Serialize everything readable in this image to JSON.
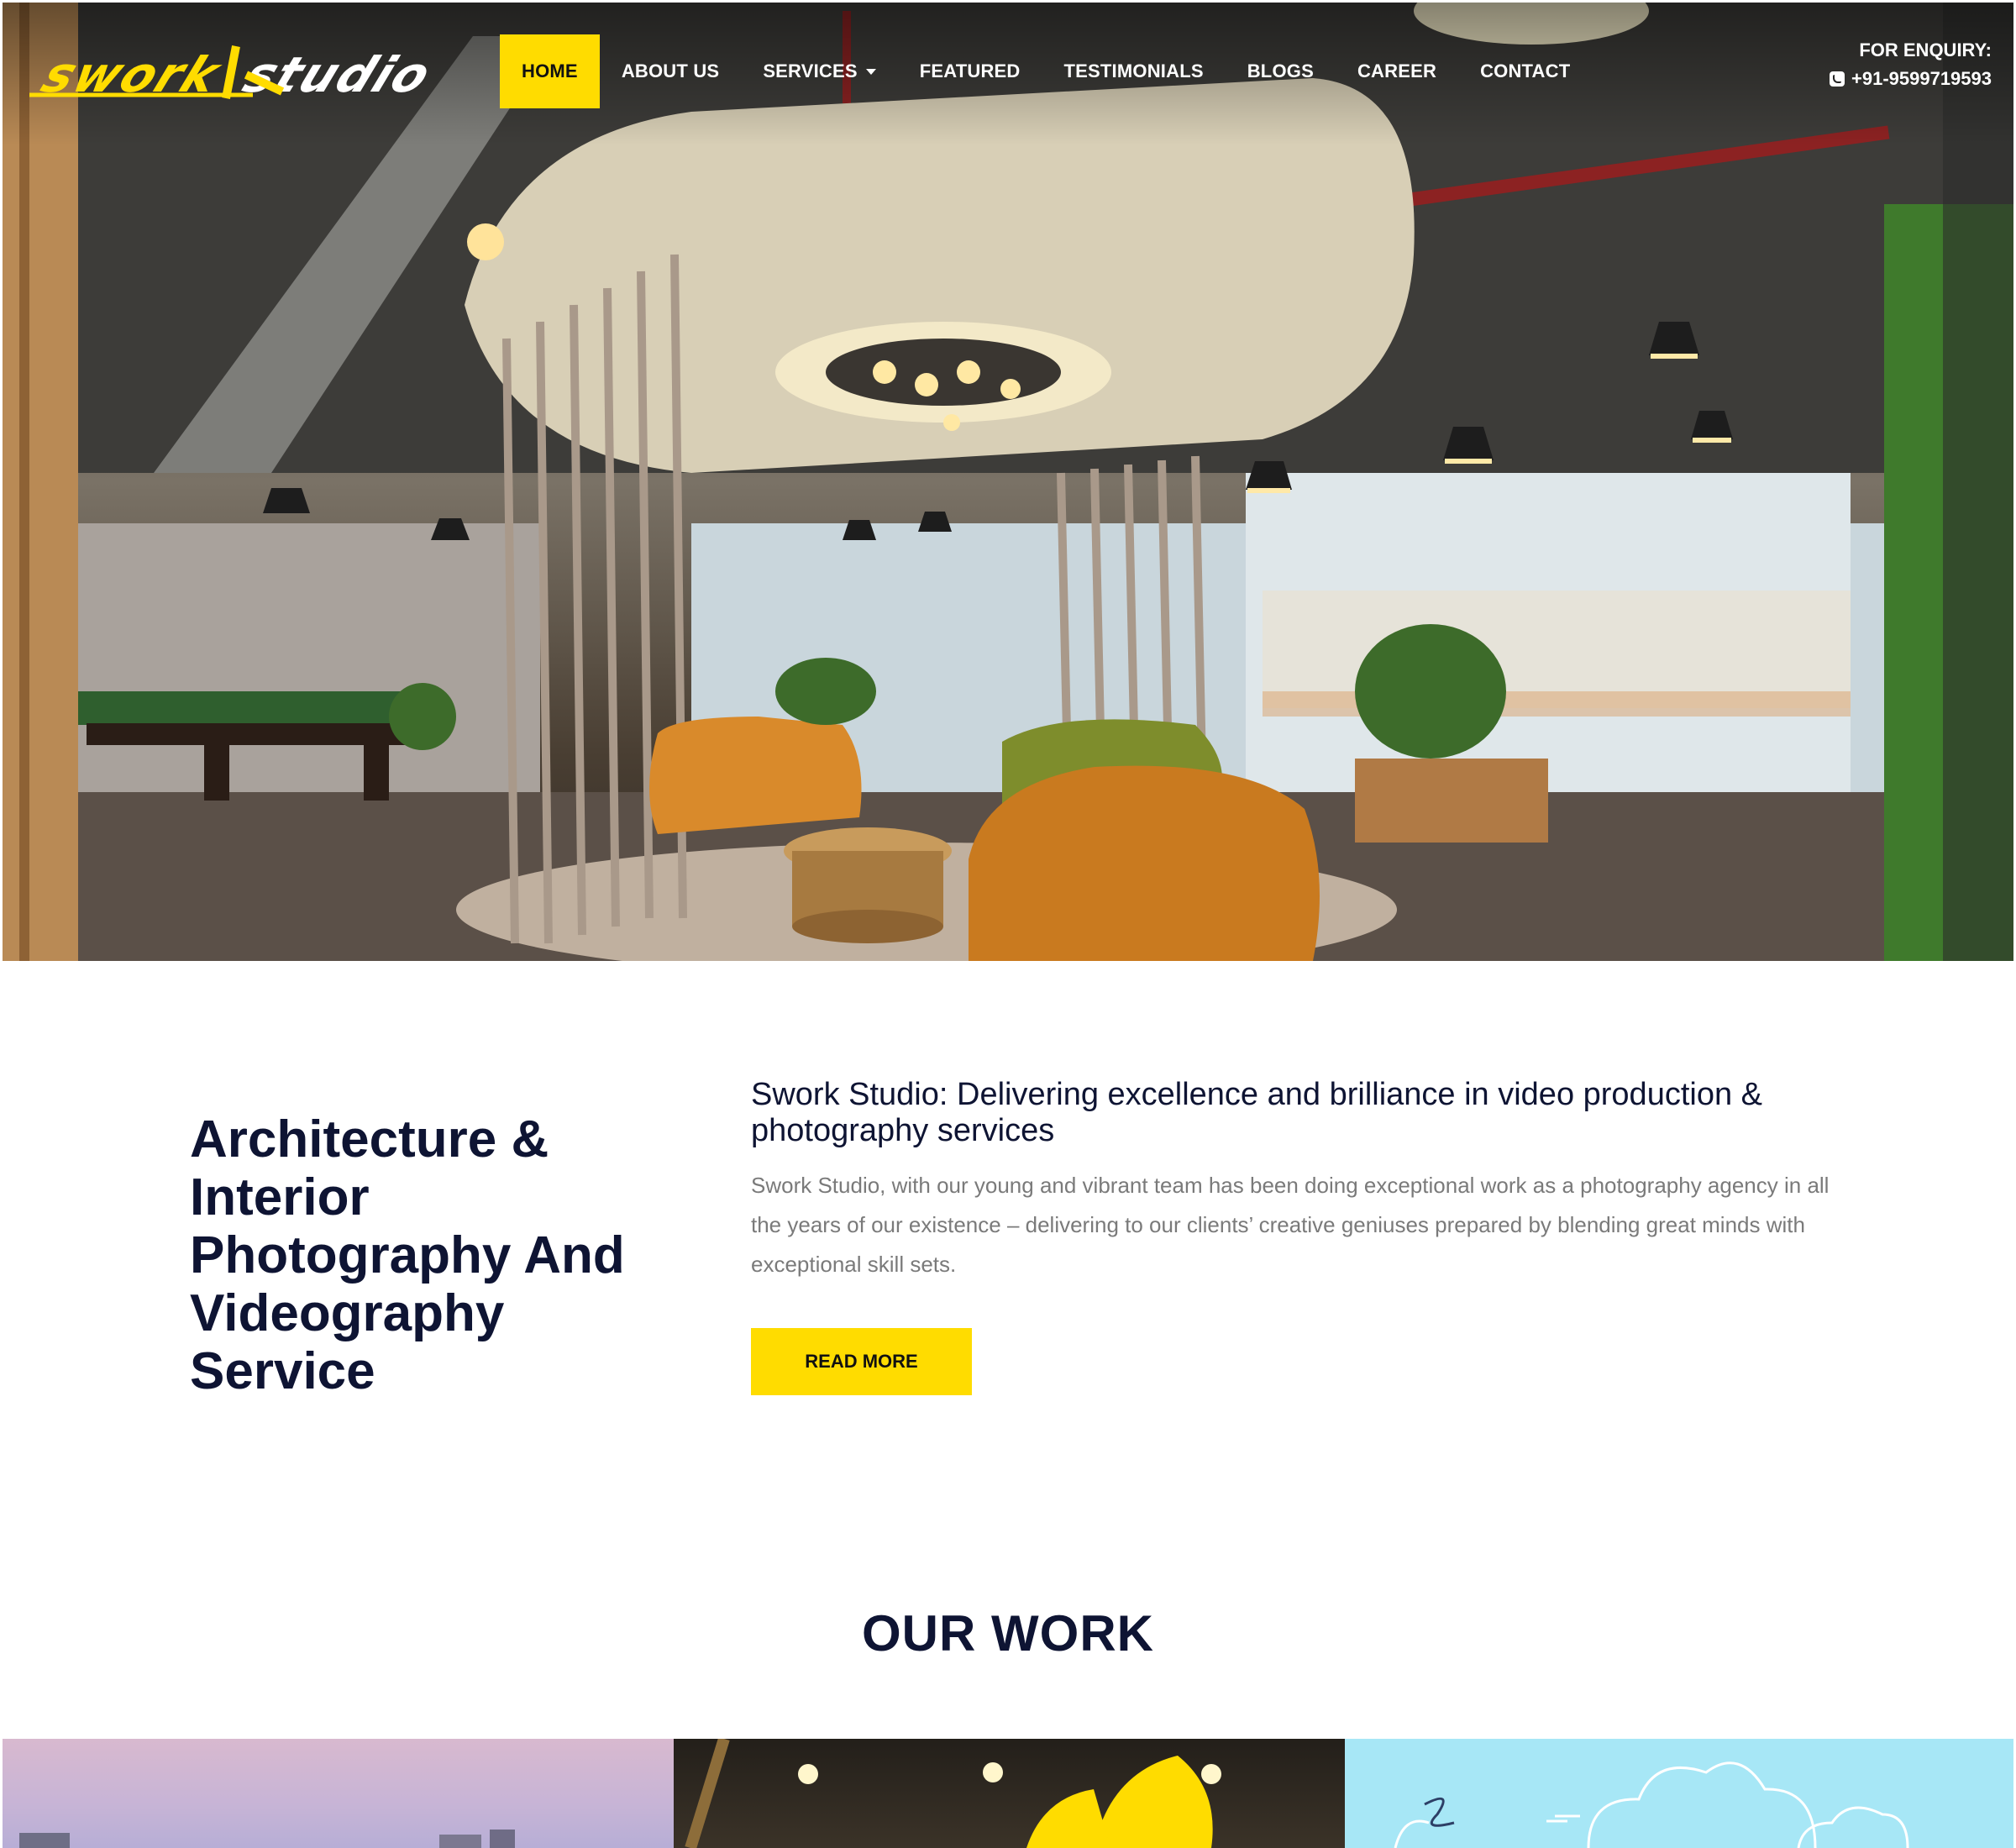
{
  "header": {
    "logo_text": "sworkstudio",
    "nav": [
      {
        "label": "HOME",
        "active": true
      },
      {
        "label": "ABOUT US"
      },
      {
        "label": "SERVICES",
        "dropdown": true
      },
      {
        "label": "FEATURED"
      },
      {
        "label": "TESTIMONIALS"
      },
      {
        "label": "BLOGS"
      },
      {
        "label": "CAREER"
      },
      {
        "label": "CONTACT"
      }
    ],
    "enquiry_label": "FOR ENQUIRY:",
    "phone": "+91-9599719593"
  },
  "intro": {
    "title": "Architecture & Interior Photography And Videography Service",
    "subtitle": "Swork Studio: Delivering excellence and brilliance in video production & photography services",
    "body": "Swork Studio, with our young and vibrant team has been doing exceptional work as a photography agency in all the years of our existence – delivering to our clients’ creative geniuses prepared by blending great minds with exceptional skill sets.",
    "button_label": "READ MORE"
  },
  "work": {
    "title": "OUR WORK"
  },
  "colors": {
    "accent": "#ffdc00",
    "heading": "#0e1433",
    "body_text": "#7a7a7a"
  },
  "icons": [
    "phone-icon",
    "chevron-down-icon"
  ]
}
